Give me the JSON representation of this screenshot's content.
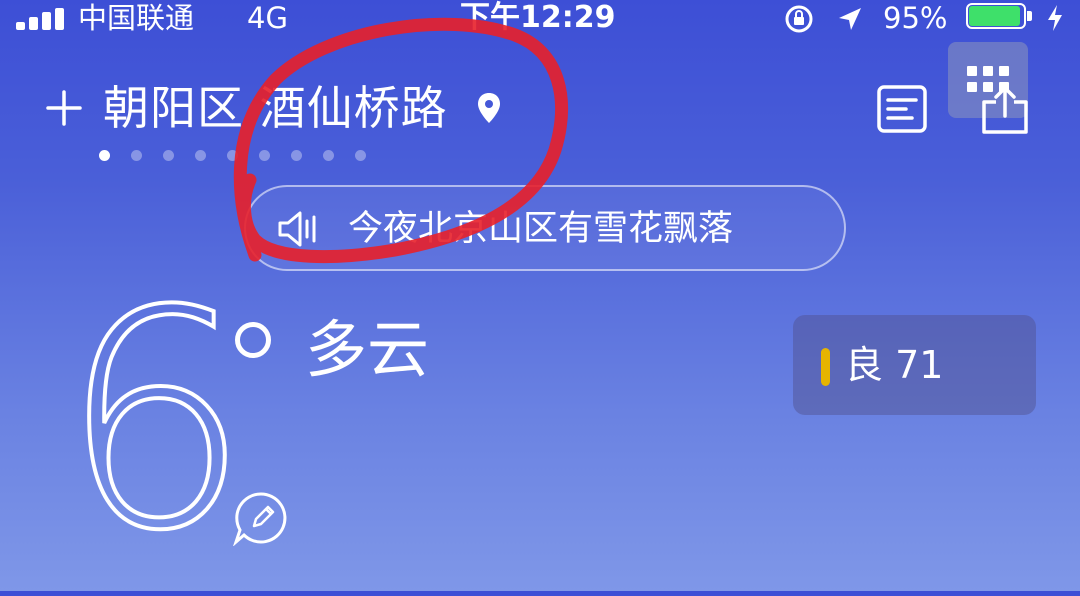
{
  "status_bar": {
    "carrier": "中国联通",
    "network": "4G",
    "time": "下午12:29",
    "battery_percent": "95%",
    "battery_level": 0.95,
    "battery_color": "#3ee06a"
  },
  "header": {
    "add_icon": "plus-icon",
    "location": "朝阳区 酒仙桥路",
    "location_icon": "location-pin-icon",
    "detail_icon": "list-icon",
    "share_icon": "share-icon",
    "page_count": 9,
    "active_page": 0
  },
  "alert": {
    "text": "今夜北京山区有雪花飘落",
    "icon": "speaker-icon"
  },
  "weather": {
    "temperature": "6",
    "unit_icon": "degree-icon",
    "condition": "多云",
    "feedback_icon": "feedback-icon"
  },
  "aqi": {
    "label": "良 71",
    "indicator_color": "#e6b400"
  },
  "annotation": {
    "color": "#e8202a"
  }
}
